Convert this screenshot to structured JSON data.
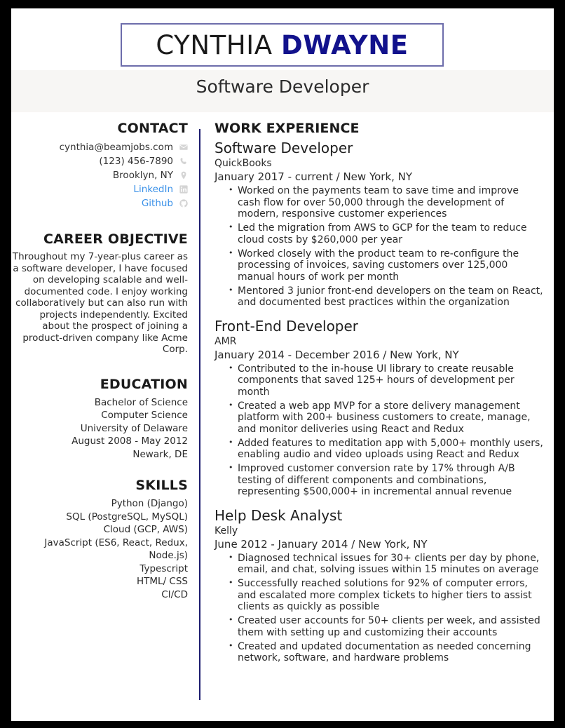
{
  "header": {
    "name_first": "CYNTHIA",
    "name_last": "DWAYNE",
    "job_title": "Software Developer",
    "accent_box_border": "#6d6dab",
    "name_last_color": "#12128c",
    "band_background": "#f7f6f4"
  },
  "theme": {
    "divider_color": "#1c1c6e",
    "link_color": "#3b91e8",
    "page_border_color": "#000000",
    "text_color": "#2b2b2b"
  },
  "sidebar": {
    "contact": {
      "heading": "CONTACT",
      "items": [
        {
          "text": "cynthia@beamjobs.com",
          "icon": "envelope-icon",
          "is_link": false
        },
        {
          "text": "(123) 456-7890",
          "icon": "phone-icon",
          "is_link": false
        },
        {
          "text": "Brooklyn, NY",
          "icon": "location-pin-icon",
          "is_link": false
        },
        {
          "text": "LinkedIn",
          "icon": "linkedin-icon",
          "is_link": true
        },
        {
          "text": "Github",
          "icon": "github-icon",
          "is_link": true
        }
      ]
    },
    "objective": {
      "heading": "CAREER OBJECTIVE",
      "body": "Throughout my 7-year-plus career as a software developer, I have focused on developing scalable and well-documented code. I enjoy working collaboratively but can also run with projects independently. Excited about the prospect of joining a product-driven company like Acme Corp."
    },
    "education": {
      "heading": "EDUCATION",
      "lines": [
        "Bachelor of Science",
        "Computer Science",
        "University of Delaware",
        "August 2008 - May 2012",
        "Newark, DE"
      ]
    },
    "skills": {
      "heading": "SKILLS",
      "items": [
        "Python (Django)",
        "SQL (PostgreSQL, MySQL)",
        "Cloud (GCP, AWS)",
        "JavaScript (ES6, React, Redux, Node.js)",
        "Typescript",
        "HTML/ CSS",
        "CI/CD"
      ]
    }
  },
  "main": {
    "work_heading": "WORK EXPERIENCE",
    "jobs": [
      {
        "title": "Software Developer",
        "company": "QuickBooks",
        "meta": "January 2017 - current  /  New York, NY",
        "bullets": [
          "Worked on the payments team to save time and improve cash flow for over 50,000 through the development of modern, responsive customer experiences",
          "Led the migration from AWS to GCP for the team to reduce cloud costs by $260,000 per year",
          "Worked closely with the product team to re-configure the processing of invoices, saving customers over 125,000 manual hours of work per month",
          "Mentored 3 junior front-end developers on the team on React, and documented best practices within the organization"
        ]
      },
      {
        "title": "Front-End Developer",
        "company": "AMR",
        "meta": "January 2014 - December 2016  /  New York, NY",
        "bullets": [
          "Contributed to the in-house UI library to create reusable components that saved 125+ hours of development per month",
          "Created a web app MVP for a store delivery management platform with 200+ business customers to create, manage, and monitor deliveries using React and Redux",
          "Added features to meditation app with 5,000+ monthly users, enabling audio and video uploads using React and Redux",
          "Improved customer conversion rate by 17% through A/B testing of different components and combinations, representing $500,000+ in incremental annual revenue"
        ]
      },
      {
        "title": "Help Desk Analyst",
        "company": "Kelly",
        "meta": "June 2012 - January 2014  /  New York, NY",
        "bullets": [
          "Diagnosed technical issues for 30+ clients per day by phone, email, and chat, solving issues within 15 minutes on average",
          "Successfully reached solutions for 92% of computer errors, and escalated more complex tickets to higher tiers to assist clients as quickly as possible",
          "Created user accounts for 50+ clients per week, and assisted them with setting up and customizing their accounts",
          "Created and updated documentation as needed concerning network, software, and hardware problems"
        ]
      }
    ]
  }
}
